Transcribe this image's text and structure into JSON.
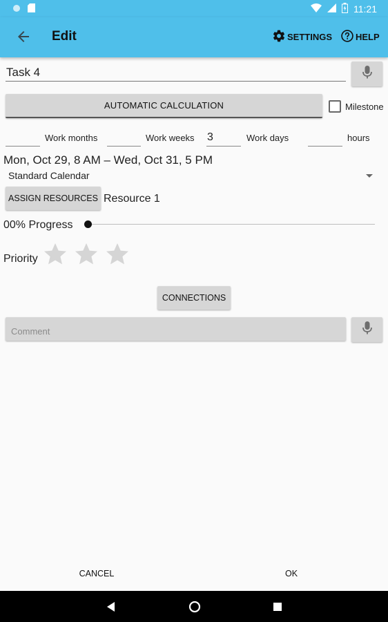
{
  "status_bar": {
    "time": "11:21"
  },
  "app_bar": {
    "title": "Edit",
    "settings_label": "SETTINGS",
    "help_label": "HELP"
  },
  "task": {
    "name": "Task 4"
  },
  "auto_calc_label": "AUTOMATIC CALCULATION",
  "milestone": {
    "label": "Milestone",
    "checked": false
  },
  "work_fields": [
    {
      "value": "",
      "label": "Work months"
    },
    {
      "value": "",
      "label": "Work weeks"
    },
    {
      "value": "3",
      "label": "Work days"
    },
    {
      "value": "",
      "label": "hours"
    }
  ],
  "date_range": "Mon, Oct 29, 8 AM – Wed, Oct 31, 5 PM",
  "calendar": {
    "selected": "Standard Calendar"
  },
  "resources": {
    "button_label": "ASSIGN RESOURCES",
    "assigned": "Resource 1"
  },
  "progress": {
    "label": "00% Progress",
    "fraction": 0.0
  },
  "priority": {
    "label": "Priority",
    "stars_total": 3,
    "stars_filled": 0
  },
  "connections_label": "CONNECTIONS",
  "comment": {
    "value": "",
    "placeholder": "Comment"
  },
  "footer": {
    "cancel_label": "CANCEL",
    "ok_label": "OK"
  },
  "colors": {
    "app_bar": "#4fbfea",
    "button": "#d6d6d6",
    "star_empty": "#d5d5d5",
    "nav_bar": "#000000"
  },
  "icons": {
    "back": "arrow-left-icon",
    "settings": "gear-icon",
    "help": "question-circle-icon",
    "mic": "microphone-icon",
    "star": "star-icon"
  }
}
